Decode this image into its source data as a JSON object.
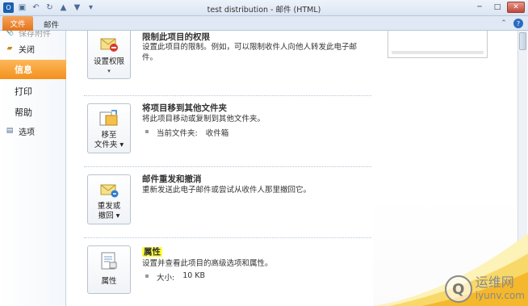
{
  "window": {
    "title": "test distribution  -  邮件 (HTML)",
    "minimize": "─",
    "maximize": "□",
    "close": "✕"
  },
  "ribbon": {
    "file_tab": "文件",
    "mail_tab": "邮件",
    "help": "?"
  },
  "nav": {
    "save_attachments": "保存附件",
    "close": "关闭",
    "info": "信息",
    "print": "打印",
    "help": "帮助",
    "options": "选项"
  },
  "sections": {
    "permissions": {
      "title": "限制此项目的权限",
      "description": "设置此项目的限制。例如，可以限制收件人向他人转发此电子邮件。",
      "button_label": "设置权限"
    },
    "move": {
      "title": "将项目移到其他文件夹",
      "description": "将此项目移动或复制到其他文件夹。",
      "bullet_label": "当前文件夹:",
      "bullet_value": "收件箱",
      "button_label_line1": "移至",
      "button_label_line2": "文件夹"
    },
    "resend": {
      "title": "邮件重发和撤消",
      "description": "重新发送此电子邮件或尝试从收件人那里撤回它。",
      "button_label_line1": "重发或",
      "button_label_line2": "撤回"
    },
    "properties": {
      "title": "属性",
      "description": "设置并查看此项目的高级选项和属性。",
      "bullet_label": "大小:",
      "bullet_value": "10 KB",
      "button_label": "属性"
    }
  },
  "watermark": {
    "brand": "运维网",
    "url": "iyunv.com",
    "logo_letter": "Q"
  },
  "colors": {
    "accent_orange": "#f4901c",
    "highlight": "#ffff3a",
    "ribbon_blue": "#dfe8f4"
  }
}
